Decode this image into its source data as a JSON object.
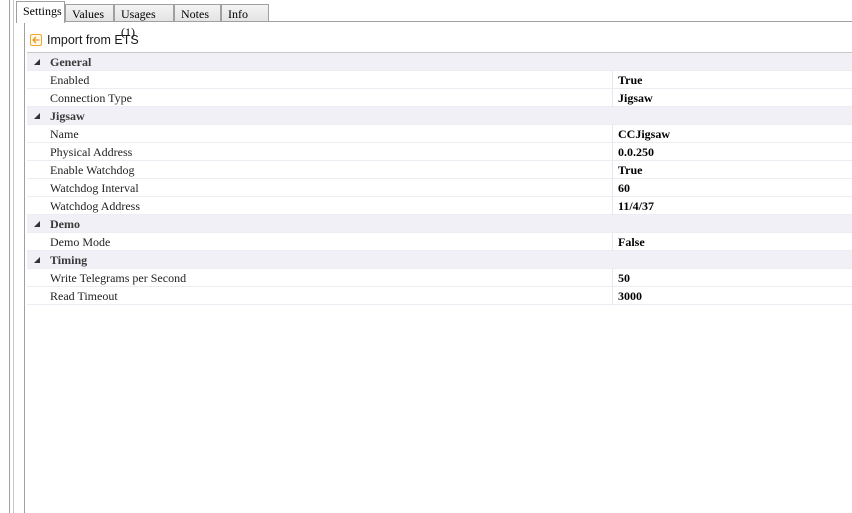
{
  "tabs": [
    {
      "label": "Settings",
      "active": true
    },
    {
      "label": "Values",
      "active": false
    },
    {
      "label": "Usages (1)",
      "active": false
    },
    {
      "label": "Notes",
      "active": false
    },
    {
      "label": "Info",
      "active": false
    }
  ],
  "toolbar": {
    "import_label": "Import from ETS",
    "import_icon": "import-arrow-icon"
  },
  "colors": {
    "category_bg": "#f0f0f6",
    "border": "#a0a0a0",
    "icon_accent": "#f0a830"
  },
  "properties": {
    "general": {
      "title": "General",
      "enabled": {
        "name": "Enabled",
        "value": "True"
      },
      "connection_type": {
        "name": "Connection Type",
        "value": "Jigsaw"
      }
    },
    "jigsaw": {
      "title": "Jigsaw",
      "name": {
        "name": "Name",
        "value": "CCJigsaw"
      },
      "physical_address": {
        "name": "Physical Address",
        "value": "0.0.250"
      },
      "enable_watchdog": {
        "name": "Enable Watchdog",
        "value": "True"
      },
      "watchdog_interval": {
        "name": "Watchdog Interval",
        "value": "60"
      },
      "watchdog_address": {
        "name": "Watchdog Address",
        "value": "11/4/37"
      }
    },
    "demo": {
      "title": "Demo",
      "demo_mode": {
        "name": "Demo Mode",
        "value": "False"
      }
    },
    "timing": {
      "title": "Timing",
      "write_telegrams": {
        "name": "Write Telegrams per Second",
        "value": "50"
      },
      "read_timeout": {
        "name": "Read Timeout",
        "value": "3000"
      }
    }
  }
}
